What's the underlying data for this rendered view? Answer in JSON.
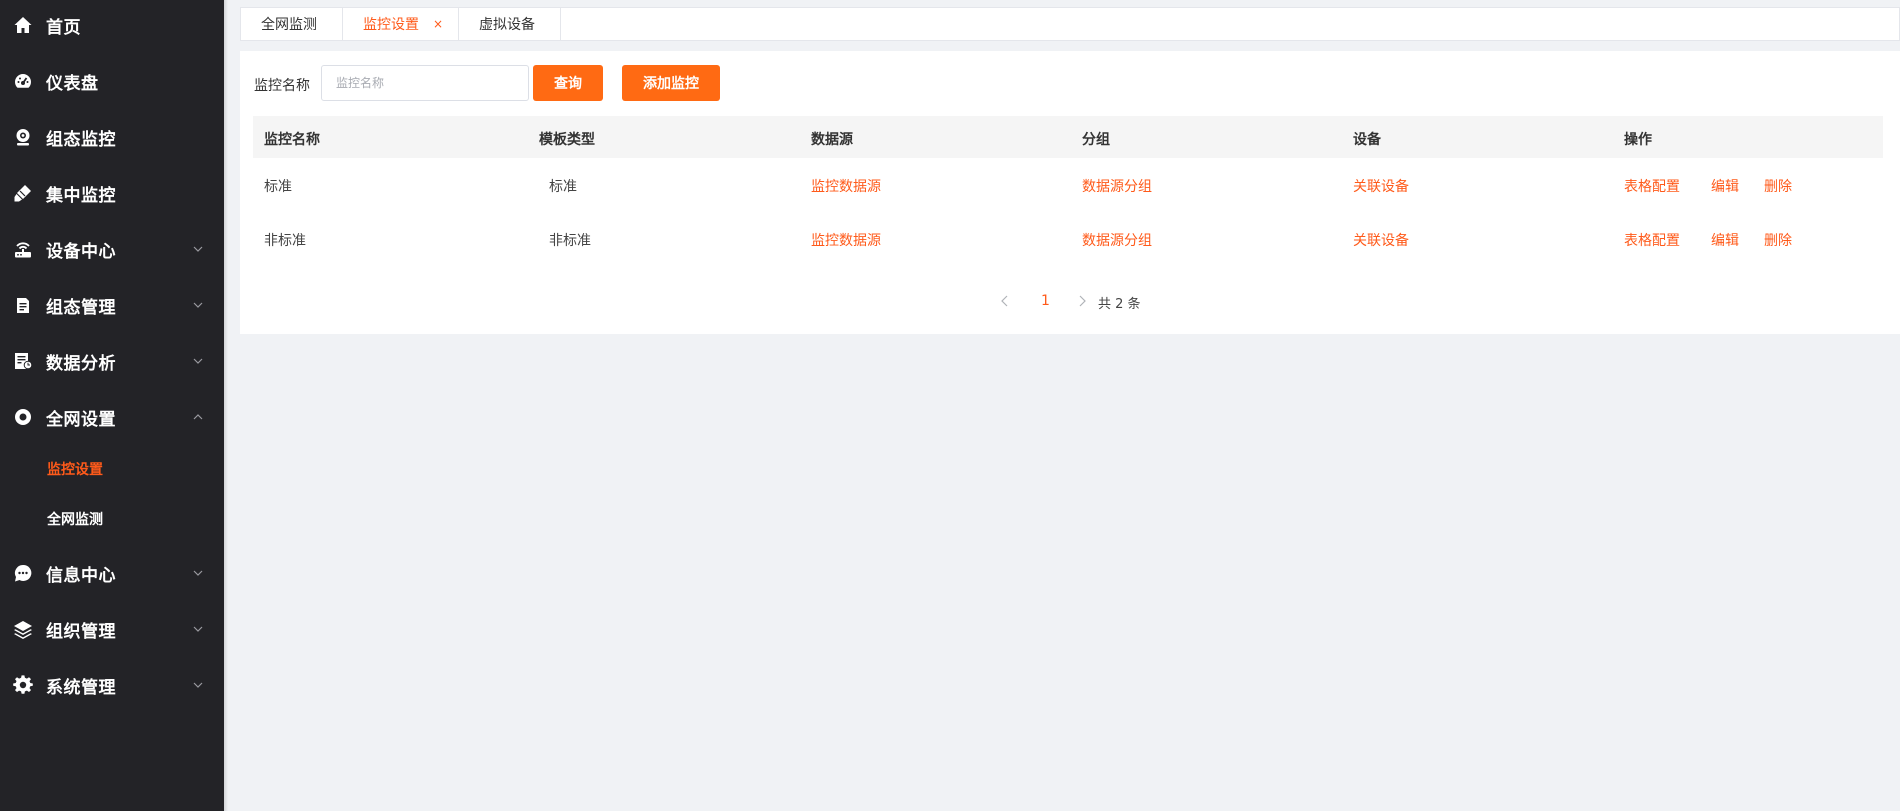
{
  "sidebar": {
    "items": [
      {
        "label": "首页",
        "icon": "home-icon",
        "expandable": false
      },
      {
        "label": "仪表盘",
        "icon": "dashboard-icon",
        "expandable": false
      },
      {
        "label": "组态监控",
        "icon": "camera-icon",
        "expandable": false
      },
      {
        "label": "集中监控",
        "icon": "brush-icon",
        "expandable": false
      },
      {
        "label": "设备中心",
        "icon": "router-icon",
        "expandable": true,
        "expanded": false
      },
      {
        "label": "组态管理",
        "icon": "clipboard-icon",
        "expandable": true,
        "expanded": false
      },
      {
        "label": "数据分析",
        "icon": "report-icon",
        "expandable": true,
        "expanded": false
      },
      {
        "label": "全网设置",
        "icon": "ring-settings-icon",
        "expandable": true,
        "expanded": true
      },
      {
        "label": "信息中心",
        "icon": "chat-bubble-icon",
        "expandable": true,
        "expanded": false
      },
      {
        "label": "组织管理",
        "icon": "layers-icon",
        "expandable": true,
        "expanded": false
      },
      {
        "label": "系统管理",
        "icon": "gear-icon",
        "expandable": true,
        "expanded": false
      }
    ],
    "subitems": [
      {
        "label": "监控设置",
        "active": true
      },
      {
        "label": "全网监测",
        "active": false
      }
    ]
  },
  "tabs": [
    {
      "label": "全网监测",
      "active": false,
      "closable": false
    },
    {
      "label": "监控设置",
      "active": true,
      "closable": true
    },
    {
      "label": "虚拟设备",
      "active": false,
      "closable": false
    }
  ],
  "search": {
    "label": "监控名称",
    "placeholder": "监控名称",
    "value": "",
    "query_button": "查询",
    "add_button": "添加监控"
  },
  "table": {
    "columns": [
      "监控名称",
      "模板类型",
      "数据源",
      "分组",
      "设备",
      "操作"
    ],
    "rows": [
      {
        "name": "标准",
        "template": "标准",
        "datasource": "监控数据源",
        "group": "数据源分组",
        "device": "关联设备",
        "actions": [
          "表格配置",
          "编辑",
          "删除"
        ]
      },
      {
        "name": "非标准",
        "template": "非标准",
        "datasource": "监控数据源",
        "group": "数据源分组",
        "device": "关联设备",
        "actions": [
          "表格配置",
          "编辑",
          "删除"
        ]
      }
    ]
  },
  "pagination": {
    "current_page": "1",
    "total_text": "共 2 条"
  },
  "colors": {
    "accent": "#ff6a13",
    "sidebar_bg": "#232327",
    "page_bg": "#f0f2f5"
  }
}
